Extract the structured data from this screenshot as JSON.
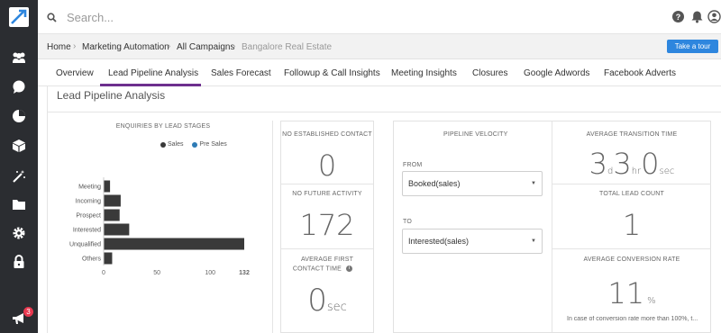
{
  "search": {
    "placeholder": "Search..."
  },
  "breadcrumb": [
    {
      "label": "Home"
    },
    {
      "label": "Marketing Automation"
    },
    {
      "label": "All Campaigns"
    },
    {
      "label": "Bangalore Real Estate"
    }
  ],
  "tour_button": {
    "label": "Take a tour"
  },
  "tabs": [
    {
      "label": "Overview"
    },
    {
      "label": "Lead Pipeline Analysis",
      "active": true
    },
    {
      "label": "Sales Forecast"
    },
    {
      "label": "Followup & Call Insights"
    },
    {
      "label": "Meeting Insights"
    },
    {
      "label": "Closures"
    },
    {
      "label": "Google Adwords"
    },
    {
      "label": "Facebook Adverts"
    }
  ],
  "sidebar": {
    "notification_count": "3",
    "icons": [
      "contacts-icon",
      "chat-icon",
      "pie-chart-icon",
      "cube-icon",
      "magic-wand-icon",
      "folder-icon",
      "settings-icon",
      "lock-icon",
      "megaphone-icon"
    ]
  },
  "section_title": "Lead Pipeline Analysis",
  "chart_data": {
    "type": "bar",
    "orientation": "horizontal",
    "title": "ENQUIRIES BY LEAD STAGES",
    "categories": [
      "Meeting",
      "Incoming",
      "Prospect",
      "Interested",
      "Unqualified",
      "Others"
    ],
    "series": [
      {
        "name": "Sales",
        "color": "#3a3a3a",
        "values": [
          6,
          16,
          15,
          24,
          132,
          8
        ]
      },
      {
        "name": "Pre Sales",
        "color": "#2e7bb5",
        "values": [
          0,
          0,
          0,
          0,
          0,
          0
        ]
      }
    ],
    "x_ticks": [
      "0",
      "50",
      "100",
      "132"
    ],
    "xlim": [
      0,
      132
    ],
    "legend_position": "top-right",
    "grid": false
  },
  "stats": {
    "no_established_contact": {
      "label": "NO ESTABLISHED CONTACT",
      "value": "0"
    },
    "no_future_activity": {
      "label": "NO FUTURE ACTIVITY",
      "value": "172"
    },
    "average_first_contact_time": {
      "label_line1": "AVERAGE FIRST",
      "label_line2": "CONTACT TIME",
      "value": "0",
      "unit": "sec"
    }
  },
  "pipeline_velocity": {
    "title": "PIPELINE VELOCITY",
    "from_label": "FROM",
    "from_value": "Booked(sales)",
    "to_label": "TO",
    "to_value": "Interested(sales)"
  },
  "transition": {
    "label": "AVERAGE TRANSITION TIME",
    "days": "3",
    "days_unit": "d",
    "hours": "3",
    "hours_unit": "hr",
    "secs": "0",
    "secs_unit": "sec"
  },
  "total_lead_count": {
    "label": "TOTAL LEAD COUNT",
    "value": "1"
  },
  "conversion": {
    "label": "AVERAGE CONVERSION RATE",
    "value": "11",
    "unit": "%",
    "note": "In case of conversion rate more than 100%, t..."
  },
  "colors": {
    "sidebar": "#2b2d31",
    "accent": "#6d2f8e",
    "button": "#2e86de",
    "bar": "#3a3a3a",
    "presales": "#2e7bb5"
  }
}
